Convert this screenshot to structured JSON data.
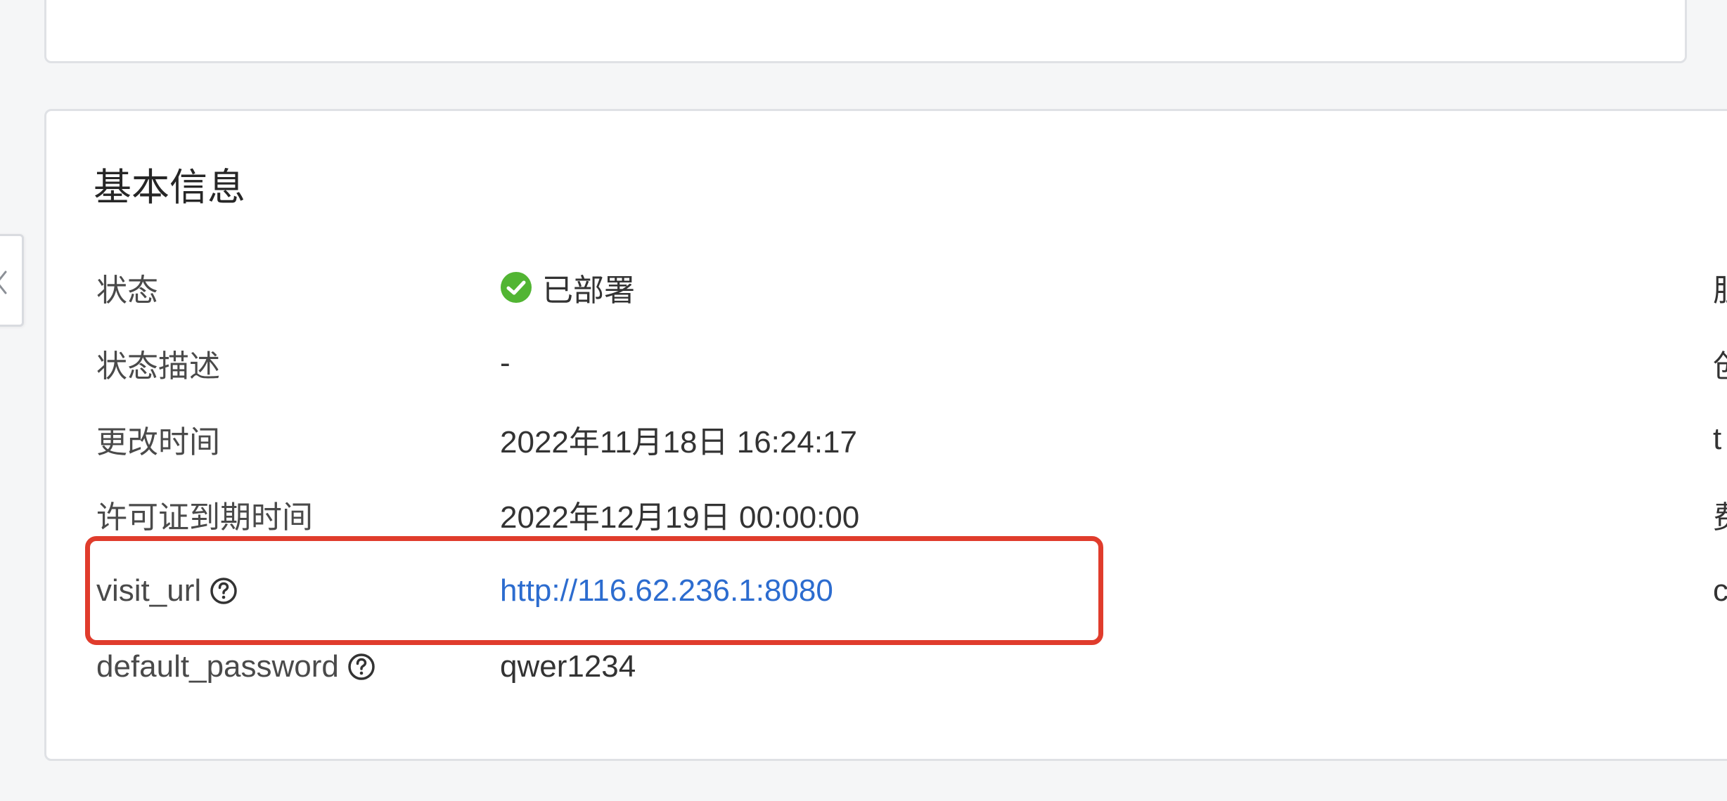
{
  "section": {
    "title": "基本信息"
  },
  "rows": [
    {
      "label": "状态",
      "value": "已部署",
      "right": "胆"
    },
    {
      "label": "状态描述",
      "value": "-",
      "right": "创"
    },
    {
      "label": "更改时间",
      "value": "2022年11月18日 16:24:17",
      "right": "t"
    },
    {
      "label": "许可证到期时间",
      "value": "2022年12月19日 00:00:00",
      "right": "费"
    },
    {
      "label": "visit_url",
      "value": "http://116.62.236.1:8080",
      "right": "c"
    },
    {
      "label": "default_password",
      "value": "qwer1234"
    }
  ],
  "icons": {
    "status": "check-circle-icon",
    "help": "question-circle-icon",
    "collapse": "chevron-left-icon"
  },
  "colors": {
    "success": "#52b533",
    "link": "#2c6ccf",
    "highlight": "#e03c2c"
  }
}
